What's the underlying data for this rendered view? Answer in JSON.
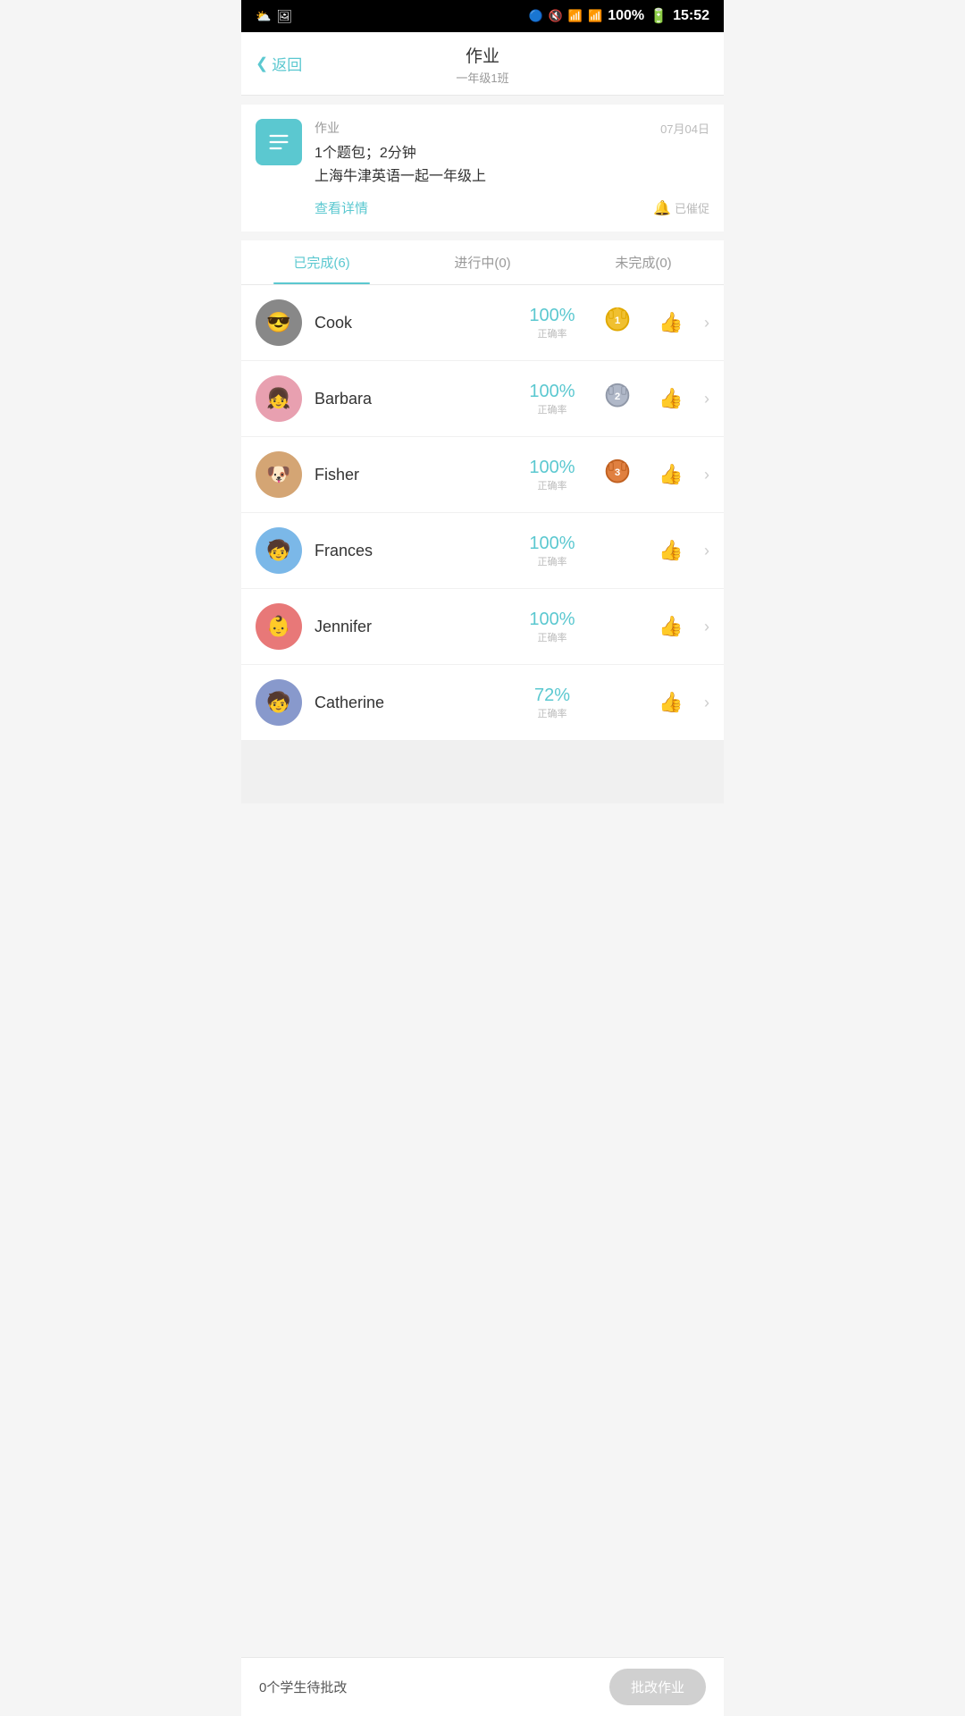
{
  "statusBar": {
    "time": "15:52",
    "battery": "100%"
  },
  "header": {
    "backLabel": "返回",
    "title": "作业",
    "subtitle": "一年级1班"
  },
  "assignment": {
    "label": "作业",
    "date": "07月04日",
    "desc1": "1个题包；2分钟",
    "desc2": "上海牛津英语一起一年级上",
    "detailLink": "查看详情",
    "remindText": "已催促"
  },
  "tabs": [
    {
      "label": "已完成(6)",
      "active": true
    },
    {
      "label": "进行中(0)",
      "active": false
    },
    {
      "label": "未完成(0)",
      "active": false
    }
  ],
  "students": [
    {
      "id": "cook",
      "name": "Cook",
      "score": "100%",
      "scoreLabel": "正确率",
      "medal": 1,
      "avatarEmoji": "😎",
      "avatarClass": "av-cook"
    },
    {
      "id": "barbara",
      "name": "Barbara",
      "score": "100%",
      "scoreLabel": "正确率",
      "medal": 2,
      "avatarEmoji": "👧",
      "avatarClass": "av-barbara"
    },
    {
      "id": "fisher",
      "name": "Fisher",
      "score": "100%",
      "scoreLabel": "正确率",
      "medal": 3,
      "avatarEmoji": "🐶",
      "avatarClass": "av-fisher"
    },
    {
      "id": "frances",
      "name": "Frances",
      "score": "100%",
      "scoreLabel": "正确率",
      "medal": 0,
      "avatarEmoji": "🧒",
      "avatarClass": "av-frances"
    },
    {
      "id": "jennifer",
      "name": "Jennifer",
      "score": "100%",
      "scoreLabel": "正确率",
      "medal": 0,
      "avatarEmoji": "👶",
      "avatarClass": "av-jennifer"
    },
    {
      "id": "catherine",
      "name": "Catherine",
      "score": "72%",
      "scoreLabel": "正确率",
      "medal": 0,
      "avatarEmoji": "🧒",
      "avatarClass": "av-catherine"
    }
  ],
  "bottomBar": {
    "pendingText": "0个学生待批改",
    "gradeButton": "批改作业"
  }
}
